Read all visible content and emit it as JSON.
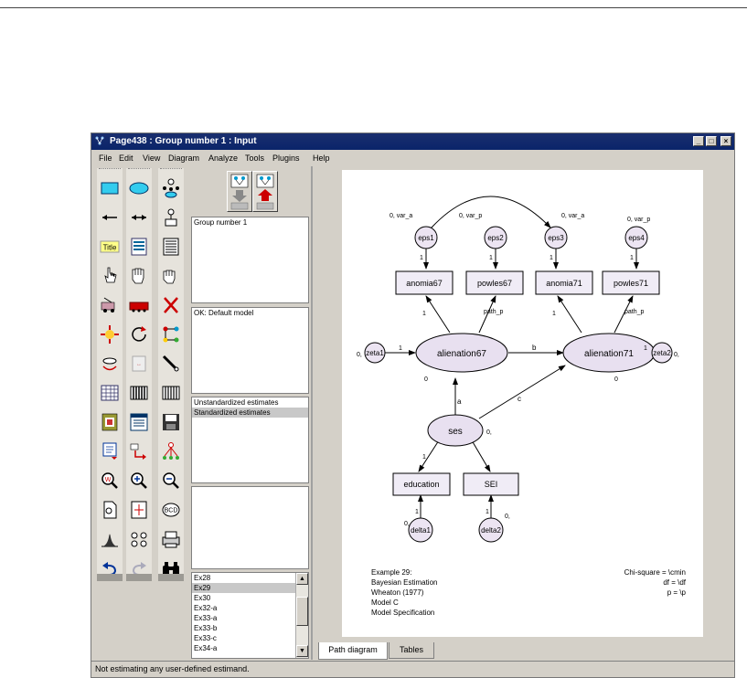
{
  "window": {
    "title": "Page438 : Group number 1 : Input",
    "min_label": "_",
    "max_label": "□",
    "close_label": "×"
  },
  "menu": [
    "File",
    "Edit",
    "View",
    "Diagram",
    "Analyze",
    "Tools",
    "Plugins",
    "Help"
  ],
  "panels": {
    "groups": [
      "Group number 1"
    ],
    "models": [
      "OK: Default model"
    ],
    "estimates": [
      "Unstandardized estimates",
      "Standardized estimates"
    ],
    "estimates_selected": 1
  },
  "file_list": {
    "items": [
      "Ex28",
      "Ex29",
      "Ex30",
      "Ex32-a",
      "Ex33-a",
      "Ex33-b",
      "Ex33-c",
      "Ex34-a"
    ],
    "selected": 1,
    "scroll_up": "▲",
    "scroll_down": "▼"
  },
  "tabs": [
    "Path diagram",
    "Tables"
  ],
  "active_tab": 0,
  "status": "Not estimating any user-defined estimand.",
  "diagram": {
    "errors": [
      {
        "name": "eps1",
        "label": "0, var_a"
      },
      {
        "name": "eps2",
        "label": "0, var_p"
      },
      {
        "name": "eps3",
        "label": "0, var_a"
      },
      {
        "name": "eps4",
        "label": "0, var_p"
      }
    ],
    "observed": [
      "anomia67",
      "powles67",
      "anomia71",
      "powles71",
      "education",
      "SEI"
    ],
    "latent": [
      "alienation67",
      "alienation71",
      "ses"
    ],
    "disturbances": [
      {
        "name": "zeta1",
        "mean": "0,"
      },
      {
        "name": "zeta2",
        "mean": "0,"
      },
      {
        "name": "delta1",
        "mean": "0,"
      },
      {
        "name": "delta2",
        "mean": "0,"
      }
    ],
    "path_labels": {
      "one": "1",
      "path_p": "path_p",
      "b": "b",
      "a": "a",
      "c": "c",
      "zero": "0",
      "ses_zero": "0,"
    },
    "caption": [
      "Example 29:",
      "Bayesian Estimation",
      "Wheaton (1977)",
      "Model C",
      "Model Specification"
    ],
    "fit": [
      "Chi-square = \\cmin",
      "df = \\df",
      "p = \\p"
    ]
  },
  "colors": {
    "title_bar": "#0a246a",
    "observed_fill": "#ece8f4",
    "latent_fill": "#e8e0f0",
    "window_bg": "#d4d0c8"
  }
}
